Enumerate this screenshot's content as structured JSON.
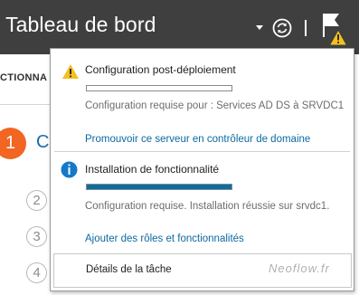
{
  "header": {
    "title": "Tableau de bord"
  },
  "background": {
    "section_heading": "CTIONNA",
    "steps": [
      "1",
      "2",
      "3",
      "4"
    ],
    "step1_text": "C"
  },
  "notifications": [
    {
      "icon": "warning-icon",
      "title": "Configuration post-déploiement",
      "progress_percent": 0,
      "description": "Configuration requise pour : Services AD DS à SRVDC1",
      "link": "Promouvoir ce serveur en contrôleur de domaine"
    },
    {
      "icon": "info-icon",
      "title": "Installation de fonctionnalité",
      "progress_percent": 100,
      "description": "Configuration requise. Installation réussie sur srvdc1.",
      "link": "Ajouter des rôles et fonctionnalités"
    }
  ],
  "footer": {
    "label": "Détails de la tâche",
    "watermark": "Neoflow.fr"
  },
  "colors": {
    "topbar": "#3f3f3f",
    "accent_link": "#0b6aa2",
    "progress_fill": "#0a6fa0",
    "step_active": "#f26522",
    "warning": "#f4c021",
    "info": "#1679c8"
  }
}
